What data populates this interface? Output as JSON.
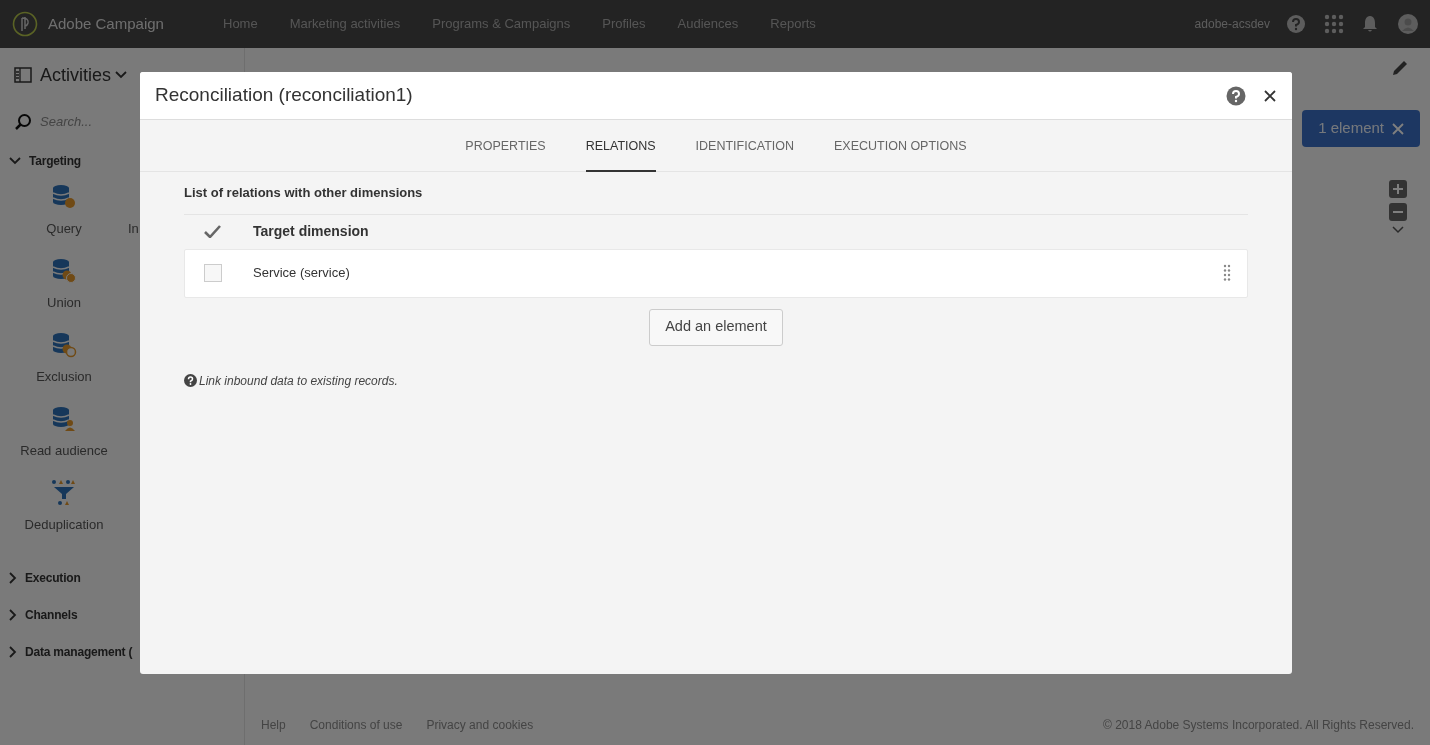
{
  "top_bar": {
    "brand": "Adobe Campaign",
    "nav": [
      {
        "label": "Home"
      },
      {
        "label": "Marketing activities"
      },
      {
        "label": "Programs & Campaigns"
      },
      {
        "label": "Profiles"
      },
      {
        "label": "Audiences"
      },
      {
        "label": "Reports"
      }
    ],
    "user": "adobe-acsdev"
  },
  "sidebar": {
    "title": "Activities",
    "search_placeholder": "Search...",
    "groups": [
      {
        "label": "Targeting",
        "expanded": true,
        "items": [
          {
            "label": "Query",
            "kind": "query",
            "column_2": "In"
          },
          {
            "label": "Union",
            "kind": "union"
          },
          {
            "label": "Exclusion",
            "kind": "exclusion"
          },
          {
            "label": "Read audience",
            "kind": "read_audience"
          },
          {
            "label": "Deduplication",
            "kind": "deduplication"
          }
        ]
      },
      {
        "label": "Execution",
        "expanded": false
      },
      {
        "label": "Channels",
        "expanded": false
      },
      {
        "label": "Data management (",
        "expanded": false
      }
    ]
  },
  "selection_badge": "1 element",
  "footer": {
    "links": [
      "Help",
      "Conditions of use",
      "Privacy and cookies"
    ],
    "copyright": "© 2018 Adobe Systems Incorporated. All Rights Reserved."
  },
  "dialog": {
    "title": "Reconciliation (reconciliation1)",
    "tabs": [
      {
        "label": "PROPERTIES",
        "selected": false
      },
      {
        "label": "RELATIONS",
        "selected": true
      },
      {
        "label": "IDENTIFICATION",
        "selected": false
      },
      {
        "label": "EXECUTION OPTIONS",
        "selected": false
      }
    ],
    "section_title": "List of relations with other dimensions",
    "table": {
      "column_header": "Target dimension",
      "rows": [
        {
          "label": "Service (service)",
          "checked": false
        }
      ]
    },
    "add_button": "Add an element",
    "note": "Link inbound data to existing records."
  }
}
